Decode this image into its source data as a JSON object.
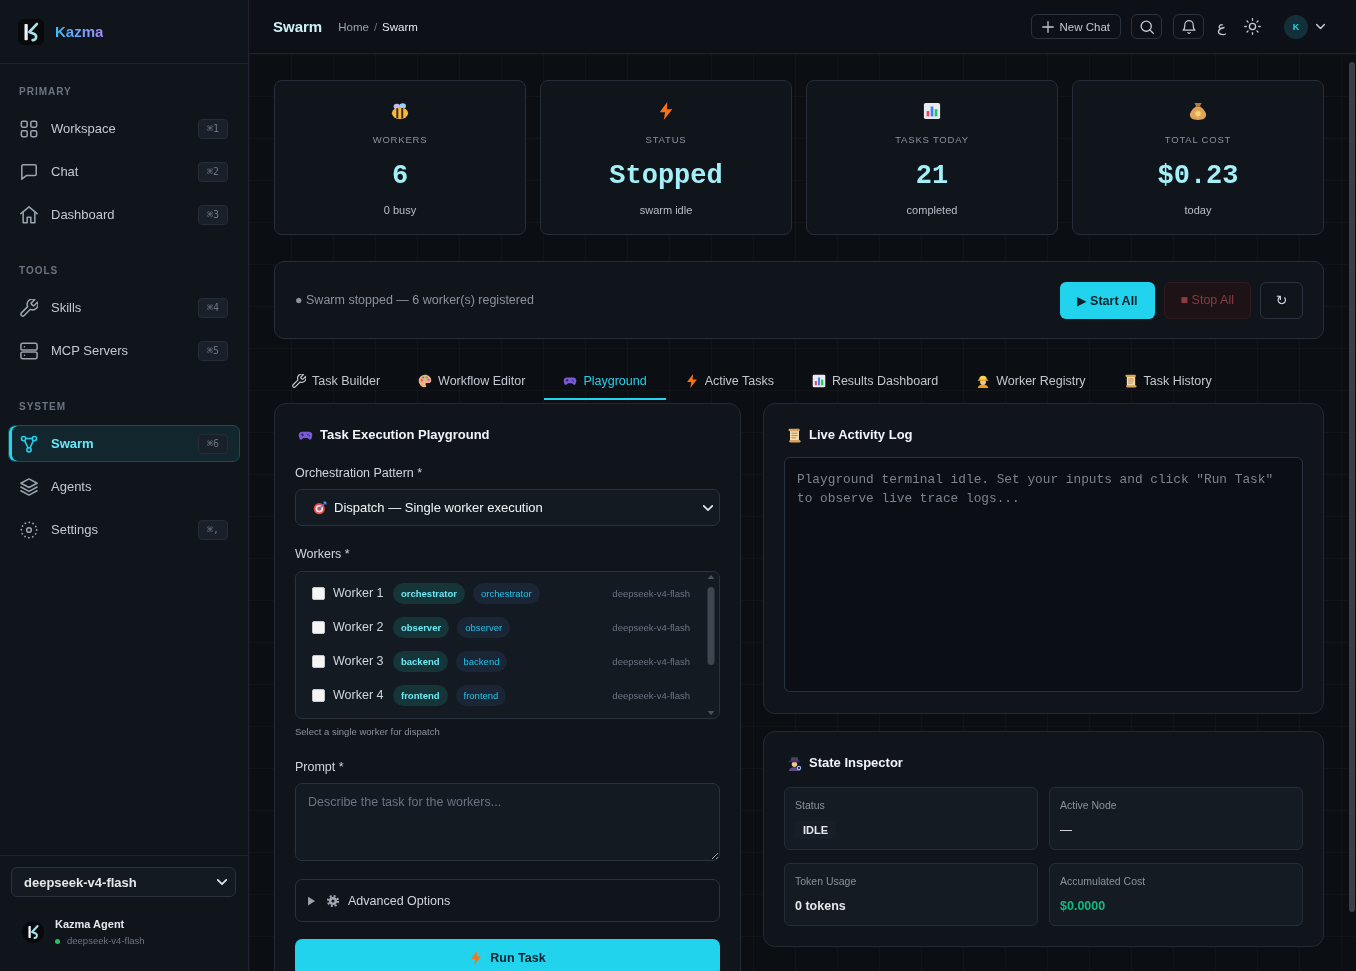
{
  "sidebar": {
    "brand": "Kazma",
    "sections": [
      {
        "label": "PRIMARY",
        "items": [
          {
            "label": "Workspace",
            "shortcut": "⌘1",
            "selected": false
          },
          {
            "label": "Chat",
            "shortcut": "⌘2",
            "selected": false
          },
          {
            "label": "Dashboard",
            "shortcut": "⌘3",
            "selected": false
          }
        ]
      },
      {
        "label": "TOOLS",
        "items": [
          {
            "label": "Skills",
            "shortcut": "⌘4",
            "selected": false
          },
          {
            "label": "MCP Servers",
            "shortcut": "⌘5",
            "selected": false
          }
        ]
      },
      {
        "label": "SYSTEM",
        "items": [
          {
            "label": "Swarm",
            "shortcut": "⌘6",
            "selected": true
          },
          {
            "label": "Agents",
            "selected": false
          },
          {
            "label": "Settings",
            "shortcut": "⌘,",
            "selected": false
          }
        ]
      }
    ],
    "model_select": {
      "value": "deepseek-v4-flash"
    },
    "agent": {
      "name": "Kazma Agent",
      "model": "deepseek-v4-flash",
      "online": true
    }
  },
  "topbar": {
    "title": "Swarm",
    "breadcrumb": [
      {
        "label": "Home",
        "current": false
      },
      {
        "label": "Swarm",
        "current": true
      }
    ],
    "separator": "/",
    "new_chat": "New Chat",
    "language": "ع",
    "avatar": "K"
  },
  "stats": [
    {
      "label": "WORKERS",
      "value": "6",
      "note": "0 busy"
    },
    {
      "label": "STATUS",
      "value": "Stopped",
      "note": "swarm idle"
    },
    {
      "label": "TASKS TODAY",
      "value": "21",
      "note": "completed"
    },
    {
      "label": "TOTAL COST",
      "value": "$0.23",
      "note": "today"
    }
  ],
  "control_bar": {
    "status": "● Swarm stopped — 6 worker(s) registered",
    "buttons": [
      {
        "label": "▶ Start All",
        "kind": "primary",
        "disabled": false
      },
      {
        "label": "■ Stop All",
        "kind": "danger",
        "disabled": true
      },
      {
        "label": "↻",
        "kind": "icon",
        "disabled": false
      }
    ]
  },
  "tabs": [
    {
      "label": "Task Builder",
      "selected": false
    },
    {
      "label": "Workflow Editor",
      "selected": false
    },
    {
      "label": "Playground",
      "selected": true
    },
    {
      "label": "Active Tasks",
      "selected": false
    },
    {
      "label": "Results Dashboard",
      "selected": false
    },
    {
      "label": "Worker Registry",
      "selected": false
    },
    {
      "label": "Task History",
      "selected": false
    }
  ],
  "playground": {
    "title": "Task Execution Playground",
    "pattern": {
      "label": "Orchestration Pattern *",
      "value": "Dispatch — Single worker execution"
    },
    "workers": {
      "label": "Workers *",
      "items": [
        {
          "name": "Worker 1",
          "checked": false,
          "badges": [
            {
              "text": "orchestrator",
              "kind": "role"
            },
            {
              "text": "orchestrator",
              "kind": "skill"
            }
          ],
          "model": "deepseek-v4-flash"
        },
        {
          "name": "Worker 2",
          "checked": false,
          "badges": [
            {
              "text": "observer",
              "kind": "role"
            },
            {
              "text": "observer",
              "kind": "skill"
            }
          ],
          "model": "deepseek-v4-flash"
        },
        {
          "name": "Worker 3",
          "checked": false,
          "badges": [
            {
              "text": "backend",
              "kind": "role"
            },
            {
              "text": "backend",
              "kind": "skill"
            }
          ],
          "model": "deepseek-v4-flash"
        },
        {
          "name": "Worker 4",
          "checked": false,
          "badges": [
            {
              "text": "frontend",
              "kind": "role"
            },
            {
              "text": "frontend",
              "kind": "skill"
            }
          ],
          "model": "deepseek-v4-flash"
        }
      ],
      "hint": "Select a single worker for dispatch"
    },
    "prompt": {
      "label": "Prompt *",
      "placeholder": "Describe the task for the workers..."
    },
    "advanced": {
      "label": "Advanced Options",
      "expanded": false
    },
    "run_button": "Run Task"
  },
  "live_log": {
    "title": "Live Activity Log",
    "text": "Playground terminal idle. Set your inputs and click \"Run Task\" to observe live trace logs..."
  },
  "state_inspector": {
    "title": "State Inspector",
    "fields": [
      {
        "label": "Status",
        "value": "IDLE",
        "kind": "badge"
      },
      {
        "label": "Active Node",
        "value": "—",
        "kind": "plain"
      },
      {
        "label": "Token Usage",
        "value": "0 tokens",
        "kind": "strong"
      },
      {
        "label": "Accumulated Cost",
        "value": "$0.0000",
        "kind": "cost"
      }
    ]
  }
}
